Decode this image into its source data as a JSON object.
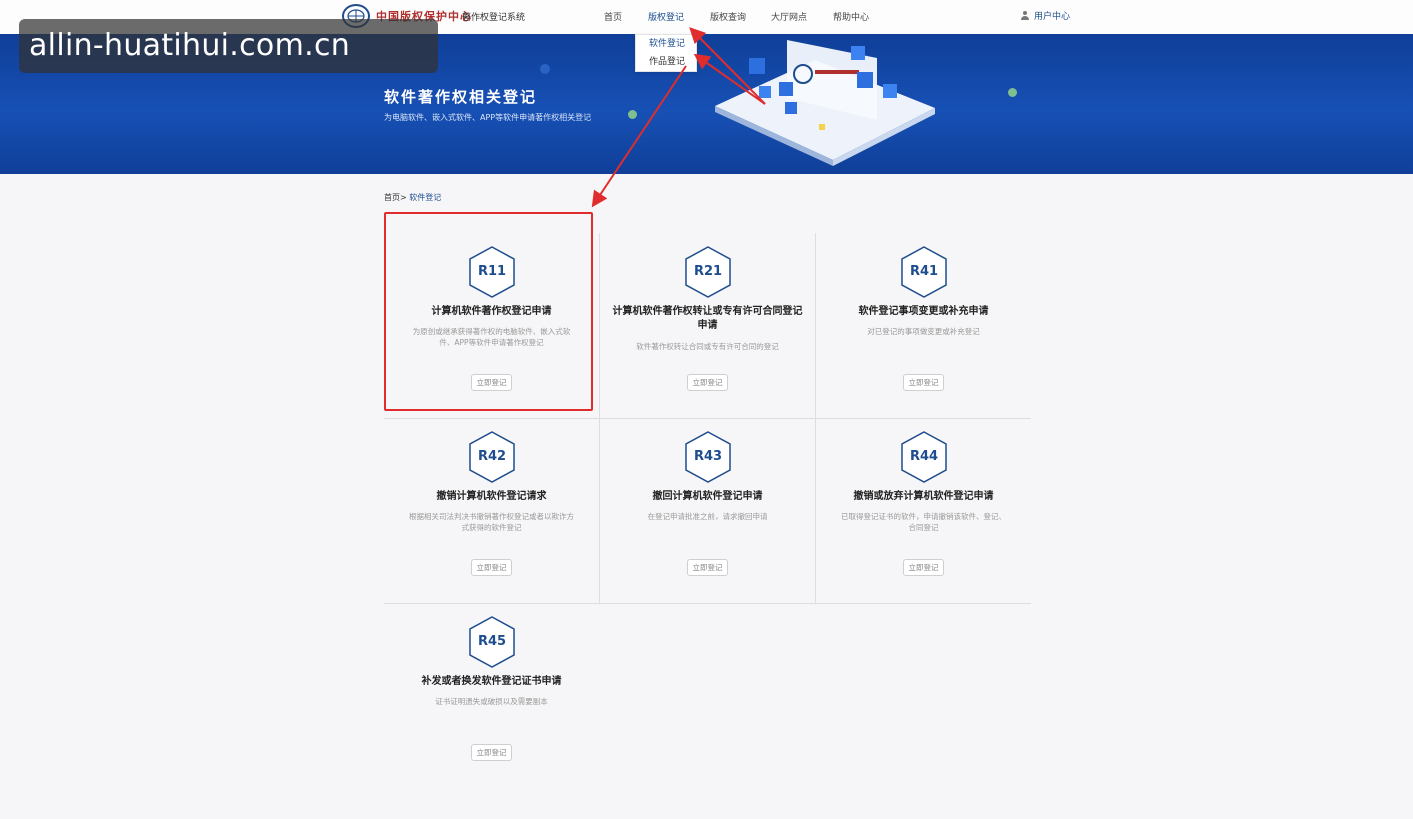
{
  "header": {
    "logo_text": "中国版权保护中心",
    "system_name": "著作权登记系统",
    "nav": [
      "首页",
      "版权登记",
      "版权查询",
      "大厅网点",
      "帮助中心"
    ],
    "active_nav": "版权登记",
    "user_center": "用户中心",
    "dropdown": [
      "软件登记",
      "作品登记"
    ]
  },
  "banner": {
    "title": "软件著作权相关登记",
    "subtitle": "为电脑软件、嵌入式软件、APP等软件申请著作权相关登记"
  },
  "breadcrumb": {
    "home": "首页>",
    "current": "软件登记"
  },
  "cards": [
    {
      "code": "R11",
      "title": "计算机软件著作权登记申请",
      "desc": "为原创或继承获得著作权的电脑软件、嵌入式软件、APP等软件申请著作权登记",
      "button": "立即登记"
    },
    {
      "code": "R21",
      "title": "计算机软件著作权转让或专有许可合同登记申请",
      "desc": "软件著作权转让合同或专有许可合同的登记",
      "button": "立即登记"
    },
    {
      "code": "R41",
      "title": "软件登记事项变更或补充申请",
      "desc": "对已登记的事项做变更或补充登记",
      "button": "立即登记"
    },
    {
      "code": "R42",
      "title": "撤销计算机软件登记请求",
      "desc": "根据相关司法判决书撤销著作权登记或者以欺诈方式获得的软件登记",
      "button": "立即登记"
    },
    {
      "code": "R43",
      "title": "撤回计算机软件登记申请",
      "desc": "在登记申请批准之前，请求撤回申请",
      "button": "立即登记"
    },
    {
      "code": "R44",
      "title": "撤销或放弃计算机软件登记申请",
      "desc": "已取得登记证书的软件，申请撤销该软件、登记、合同登记",
      "button": "立即登记"
    },
    {
      "code": "R45",
      "title": "补发或者换发软件登记证书申请",
      "desc": "证书证明遗失或破损以及需要副本",
      "button": "立即登记"
    }
  ],
  "watermark": "allin-huatihui.com.cn",
  "colors": {
    "primary": "#1e4d8f",
    "banner": "#1750b5",
    "highlight": "#e02c2c"
  }
}
